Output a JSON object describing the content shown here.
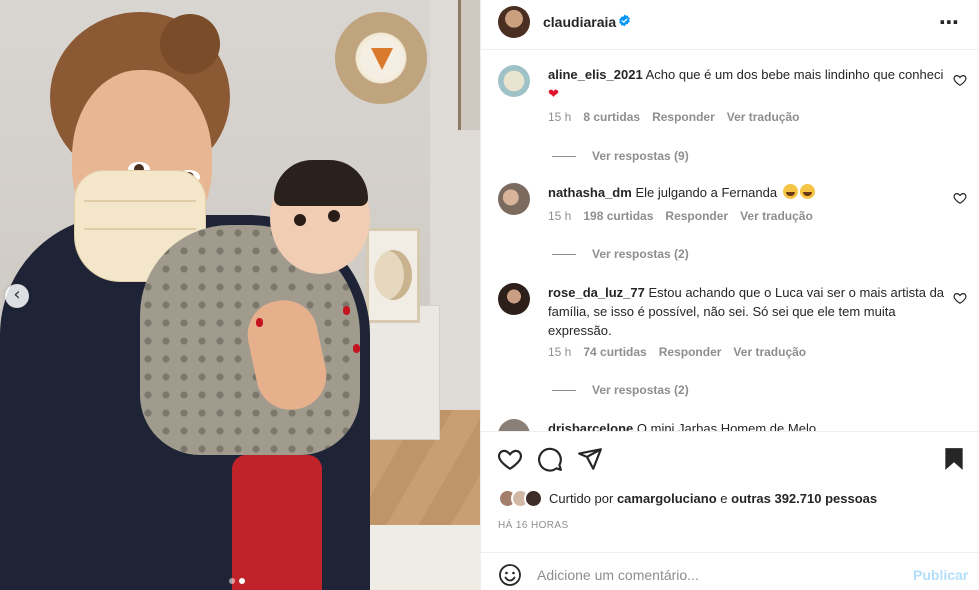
{
  "post": {
    "author": "claudiaraia",
    "more_icon": "more-horizontal-icon"
  },
  "comments": [
    {
      "user": "aline_elis_2021",
      "text": "Acho que é um dos bebe mais lindinho que conheci",
      "emoji": "❤",
      "time": "15 h",
      "likes": "8 curtidas",
      "reply_label": "Responder",
      "translate_label": "Ver tradução",
      "replies": "Ver respostas (9)"
    },
    {
      "user": "nathasha_dm",
      "text": "Ele julgando a Fernanda",
      "time": "15 h",
      "likes": "198 curtidas",
      "reply_label": "Responder",
      "translate_label": "Ver tradução",
      "replies": "Ver respostas (2)"
    },
    {
      "user": "rose_da_luz_77",
      "text": "Estou achando que o Luca vai ser o mais artista da família, se isso é possível, não sei. Só sei que ele tem muita expressão.",
      "time": "15 h",
      "likes": "74 curtidas",
      "reply_label": "Responder",
      "translate_label": "Ver tradução",
      "replies": "Ver respostas (2)"
    },
    {
      "user": "drisbarcelone",
      "text": "O mini Jarbas Homem de Melo"
    }
  ],
  "actions": {
    "liked_by_prefix": "Curtido por",
    "liked_by_user": "camargoluciano",
    "liked_by_connector": "e",
    "liked_by_others": "outras 392.710 pessoas",
    "timestamp": "HÁ 16 HORAS"
  },
  "comment_box": {
    "placeholder": "Adicione um comentário...",
    "publish_label": "Publicar"
  },
  "colors": {
    "verified": "#0095f6",
    "publish_disabled": "#b2dffc",
    "heart": "#e0122b"
  }
}
